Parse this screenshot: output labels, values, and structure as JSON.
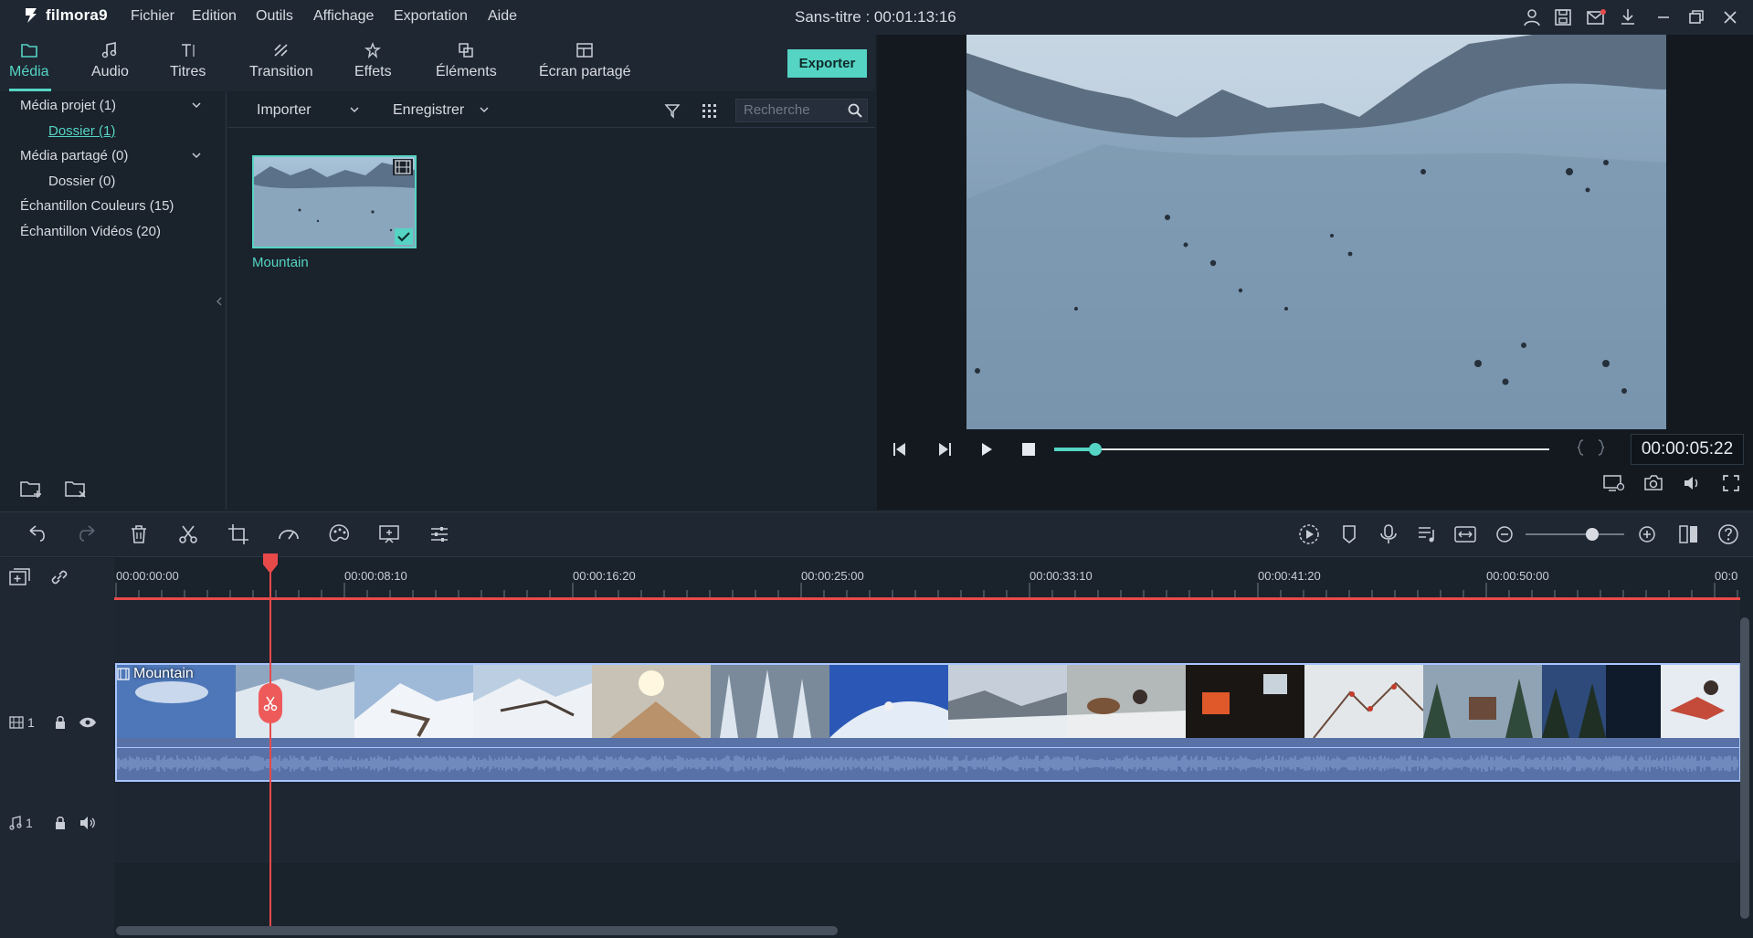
{
  "app": {
    "name": "filmora9",
    "document_title": "Sans-titre : 00:01:13:16"
  },
  "menu": [
    "Fichier",
    "Edition",
    "Outils",
    "Affichage",
    "Exportation",
    "Aide"
  ],
  "media_tabs": [
    {
      "label": "Média",
      "icon": "folder-icon",
      "active": true
    },
    {
      "label": "Audio",
      "icon": "music-note-icon",
      "active": false
    },
    {
      "label": "Titres",
      "icon": "titles-icon",
      "active": false
    },
    {
      "label": "Transition",
      "icon": "transition-icon",
      "active": false
    },
    {
      "label": "Effets",
      "icon": "effects-icon",
      "active": false
    },
    {
      "label": "Éléments",
      "icon": "elements-icon",
      "active": false
    },
    {
      "label": "Écran partagé",
      "icon": "split-screen-icon",
      "active": false
    }
  ],
  "export_button": "Exporter",
  "folders": {
    "project_media": "Média projet (1)",
    "project_folder": "Dossier (1)",
    "shared_media": "Média partagé (0)",
    "shared_folder": "Dossier (0)",
    "color_samples": "Échantillon Couleurs (15)",
    "video_samples": "Échantillon Vidéos (20)"
  },
  "library": {
    "import_label": "Importer",
    "record_label": "Enregistrer",
    "search_placeholder": "Recherche",
    "items": [
      {
        "name": "Mountain",
        "selected": true
      }
    ]
  },
  "preview": {
    "current_time": "00:00:05:22",
    "progress": 0.083
  },
  "timeline": {
    "ruler_labels": [
      "00:00:00:00",
      "00:00:08:10",
      "00:00:16:20",
      "00:00:25:00",
      "00:00:33:10",
      "00:00:41:20",
      "00:00:50:00",
      "00:0"
    ],
    "video_track": {
      "number": "1",
      "clip_name": "Mountain"
    },
    "audio_track": {
      "number": "1"
    },
    "zoom_level": 0.68
  },
  "colors": {
    "accent": "#55d4c4",
    "playhead": "#e84a4a",
    "clip_border": "#a9c4ff",
    "audio": "#5872a8"
  }
}
